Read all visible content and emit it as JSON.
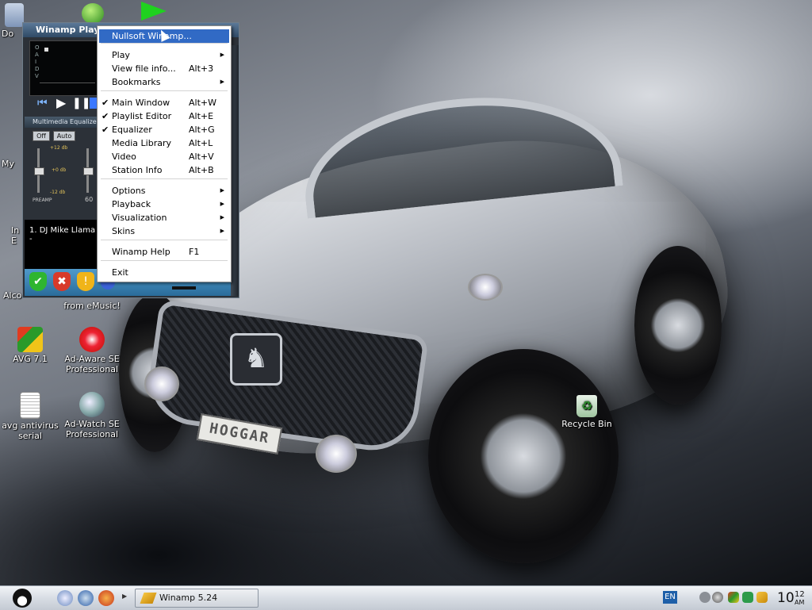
{
  "desktop": {
    "icons": [
      {
        "label": "Do",
        "icon": "documents-icon"
      },
      {
        "label": "My",
        "icon": "my-computer-icon"
      },
      {
        "label": "In",
        "icon": "internet-icon"
      },
      {
        "label": "E",
        "icon": "internet-icon"
      },
      {
        "label": "Alco",
        "icon": "alcohol-icon"
      },
      {
        "label": "from eMusic!",
        "icon": "emusic-icon"
      },
      {
        "label": "AVG 7.1",
        "icon": "avg-icon"
      },
      {
        "label": "Ad-Aware SE Professional",
        "icon": "adaware-icon"
      },
      {
        "label": "avg antivirus serial",
        "icon": "text-file-icon"
      },
      {
        "label": "Ad-Watch SE Professional",
        "icon": "adwatch-icon"
      },
      {
        "label": "Recycle Bin",
        "icon": "recycle-bin-icon"
      }
    ],
    "car_plate": "HOGGAR"
  },
  "winamp": {
    "title": "Winamp Player",
    "eq_title": "Multimedia Equalizer",
    "eq_off": "Off",
    "eq_auto": "Auto",
    "eq_preamp": "PREAMP",
    "eq_db_plus": "+12 db",
    "eq_db_zero": "+0 db",
    "eq_db_minus": "-12 db",
    "eq_band": "60",
    "playlist_item": "1. DJ Mike Llama -"
  },
  "context_menu": {
    "items": [
      {
        "label": "Nullsoft Winamp...",
        "shortcut": "",
        "checked": false,
        "submenu": false
      },
      {
        "label": "Play",
        "shortcut": "",
        "checked": false,
        "submenu": true
      },
      {
        "label": "View file info...",
        "shortcut": "Alt+3",
        "checked": false,
        "submenu": false
      },
      {
        "label": "Bookmarks",
        "shortcut": "",
        "checked": false,
        "submenu": true
      },
      {
        "label": "Main Window",
        "shortcut": "Alt+W",
        "checked": true,
        "submenu": false
      },
      {
        "label": "Playlist Editor",
        "shortcut": "Alt+E",
        "checked": true,
        "submenu": false
      },
      {
        "label": "Equalizer",
        "shortcut": "Alt+G",
        "checked": true,
        "submenu": false
      },
      {
        "label": "Media Library",
        "shortcut": "Alt+L",
        "checked": false,
        "submenu": false
      },
      {
        "label": "Video",
        "shortcut": "Alt+V",
        "checked": false,
        "submenu": false
      },
      {
        "label": "Station Info",
        "shortcut": "Alt+B",
        "checked": false,
        "submenu": false
      },
      {
        "label": "Options",
        "shortcut": "",
        "checked": false,
        "submenu": true
      },
      {
        "label": "Playback",
        "shortcut": "",
        "checked": false,
        "submenu": true
      },
      {
        "label": "Visualization",
        "shortcut": "",
        "checked": false,
        "submenu": true
      },
      {
        "label": "Skins",
        "shortcut": "",
        "checked": false,
        "submenu": true
      },
      {
        "label": "Winamp Help",
        "shortcut": "F1",
        "checked": false,
        "submenu": false
      },
      {
        "label": "Exit",
        "shortcut": "",
        "checked": false,
        "submenu": false
      }
    ],
    "check_glyph": "✔",
    "arrow_glyph": "▶"
  },
  "taskbar": {
    "winamp_task": "Winamp 5.24",
    "language": "EN",
    "clock_time": "10",
    "clock_minutes": "12",
    "clock_ampm": "AM"
  },
  "colors": {
    "menu_highlight": "#316ac5",
    "taskbar": "#d8dde4"
  }
}
